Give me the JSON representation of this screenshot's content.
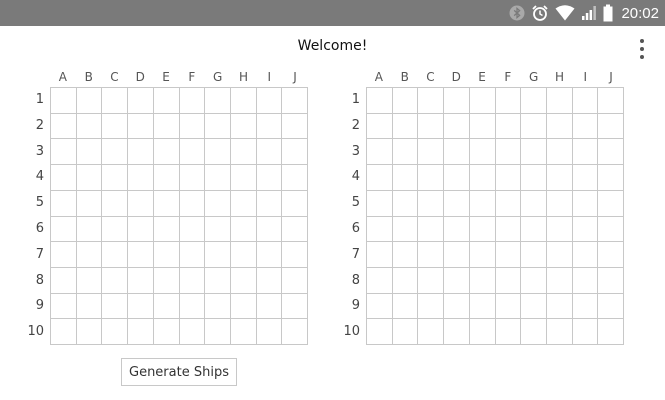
{
  "status_bar": {
    "time": "20:02",
    "icons": [
      "bluetooth-icon",
      "alarm-icon",
      "wifi-icon",
      "signal-icon",
      "battery-icon"
    ]
  },
  "header": {
    "title": "Welcome!",
    "menu_icon": "overflow-menu-icon"
  },
  "boards": {
    "left": {
      "columns": [
        "A",
        "B",
        "C",
        "D",
        "E",
        "F",
        "G",
        "H",
        "I",
        "J"
      ],
      "rows": [
        "1",
        "2",
        "3",
        "4",
        "5",
        "6",
        "7",
        "8",
        "9",
        "10"
      ]
    },
    "right": {
      "columns": [
        "A",
        "B",
        "C",
        "D",
        "E",
        "F",
        "G",
        "H",
        "I",
        "J"
      ],
      "rows": [
        "1",
        "2",
        "3",
        "4",
        "5",
        "6",
        "7",
        "8",
        "9",
        "10"
      ]
    }
  },
  "actions": {
    "generate_label": "Generate Ships"
  },
  "colors": {
    "status_bar": "#7a7a7a",
    "grid_line": "#c8c8c8",
    "background": "#ffffff"
  }
}
